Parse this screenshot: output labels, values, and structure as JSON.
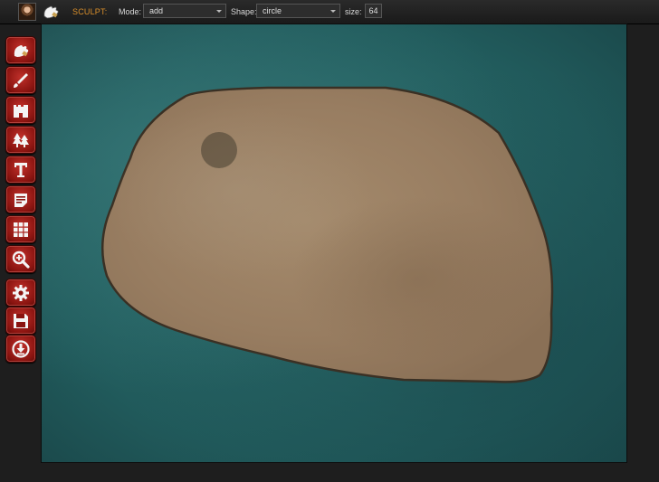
{
  "toolbar": {
    "tool_label": "SCULPT:",
    "mode_label": "Mode:",
    "mode_value": "add",
    "shape_label": "Shape:",
    "shape_value": "circle",
    "size_label": "size:",
    "size_value": "64"
  },
  "tools": [
    {
      "icon": "sculpt-hand-icon"
    },
    {
      "icon": "paint-brush-icon"
    },
    {
      "icon": "castle-icon"
    },
    {
      "icon": "trees-icon"
    },
    {
      "icon": "text-icon"
    },
    {
      "icon": "notes-icon"
    },
    {
      "icon": "grid-icon"
    },
    {
      "icon": "zoom-icon"
    },
    {
      "icon": "gear-icon"
    },
    {
      "icon": "save-icon"
    },
    {
      "icon": "download-icon"
    }
  ],
  "colors": {
    "accent": "#d98e2a",
    "button_red": "#8a1410",
    "water": "#2a6a6a",
    "land": "#9c8265"
  }
}
